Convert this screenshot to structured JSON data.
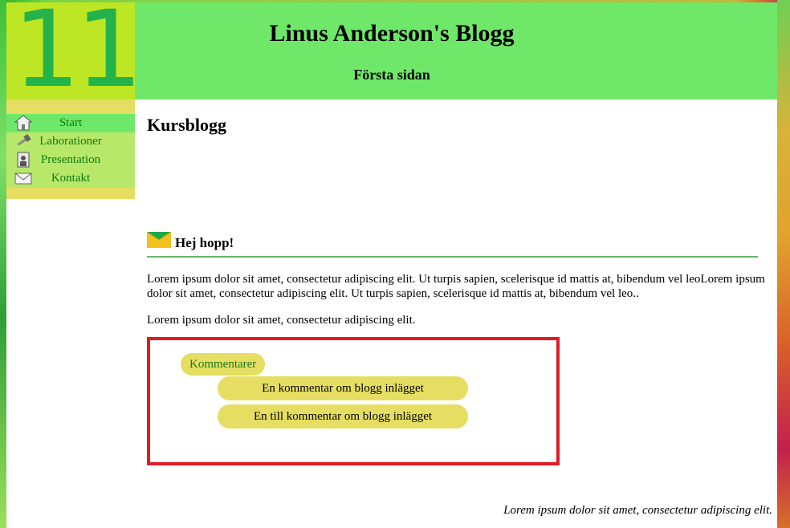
{
  "logo": {
    "text": "11"
  },
  "header": {
    "title": "Linus Anderson's Blogg",
    "subtitle": "Första sidan"
  },
  "nav": {
    "items": [
      {
        "label": "Start",
        "icon": "home-icon",
        "active": true
      },
      {
        "label": "Laborationer",
        "icon": "hammer-icon",
        "active": false
      },
      {
        "label": "Presentation",
        "icon": "portrait-icon",
        "active": false
      },
      {
        "label": "Kontakt",
        "icon": "envelope-icon",
        "active": false
      }
    ]
  },
  "main": {
    "section_title": "Kursblogg",
    "post": {
      "title": "Hej hopp!",
      "icon": "envelope-icon",
      "paragraphs": [
        "Lorem ipsum dolor sit amet, consectetur adipiscing elit. Ut turpis sapien, scelerisque id mattis at, bibendum vel leoLorem ipsum dolor sit amet, consectetur adipiscing elit. Ut turpis sapien, scelerisque id mattis at, bibendum vel leo..",
        "Lorem ipsum dolor sit amet, consectetur adipiscing elit."
      ]
    },
    "comments": {
      "label": "Kommentarer",
      "items": [
        "En kommentar om blogg inlägget",
        "En till kommentar om blogg inlägget"
      ]
    },
    "footer_text": "Lorem ipsum dolor sit amet, consectetur adipiscing elit."
  },
  "colors": {
    "header_green": "#6fe86a",
    "logo_lime": "#bde624",
    "nav_yellow": "#e6de62",
    "nav_item": "#b8e86a",
    "link_green": "#0c7a0c",
    "highlight_red": "#e01b24"
  }
}
